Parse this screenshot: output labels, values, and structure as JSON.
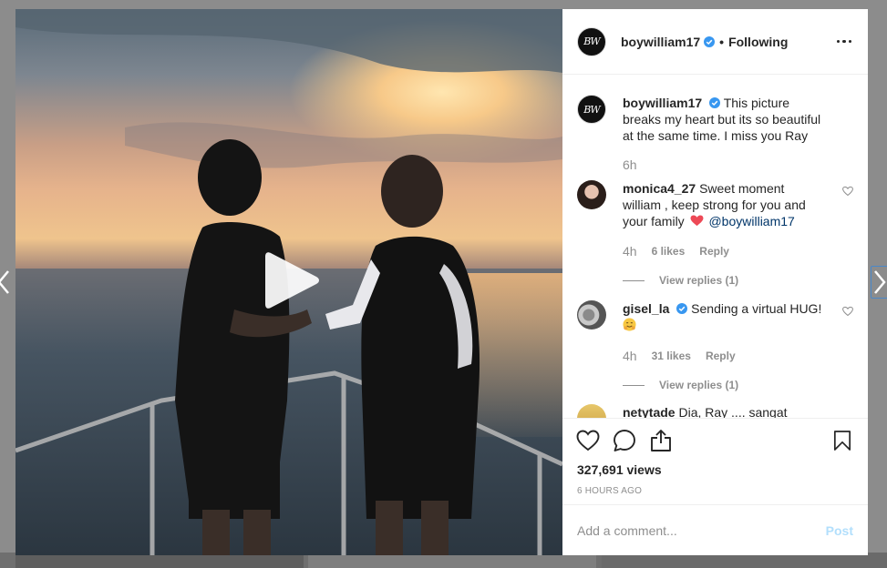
{
  "post": {
    "username": "boywilliam17",
    "follow_status": "Following",
    "separator": "•",
    "avatar_text": "BW"
  },
  "caption": {
    "username": "boywilliam17",
    "text": "This picture breaks my heart but its so beautiful at the same time. I miss you Ray",
    "time": "6h"
  },
  "comments": [
    {
      "username": "monica4_27",
      "text": "Sweet moment william , keep strong for you and your family",
      "emoji": "❤️",
      "mention": "@boywilliam17",
      "time": "4h",
      "likes": "6 likes",
      "reply": "Reply",
      "view_replies": "View replies (1)"
    },
    {
      "username": "gisel_la",
      "text": "Sending a virtual HUG!",
      "emoji": "🤗",
      "time": "4h",
      "likes": "31 likes",
      "reply": "Reply",
      "view_replies": "View replies (1)"
    },
    {
      "username": "netytade",
      "text": "Dia, Ray .... sangat"
    }
  ],
  "stats": {
    "views": "327,691 views",
    "posted": "6 HOURS AGO"
  },
  "composer": {
    "placeholder": "Add a comment...",
    "post_label": "Post"
  },
  "colors": {
    "verified": "#3897f0",
    "heart_emoji": "#ed4956",
    "mention": "#003569",
    "post_button": "#b2dffc"
  },
  "icons": {
    "like": "heart-outline-icon",
    "comment": "speech-bubble-icon",
    "share": "share-upload-icon",
    "save": "bookmark-icon",
    "more": "ellipsis-icon",
    "play": "play-icon",
    "prev": "chevron-left-icon",
    "next": "chevron-right-icon"
  }
}
